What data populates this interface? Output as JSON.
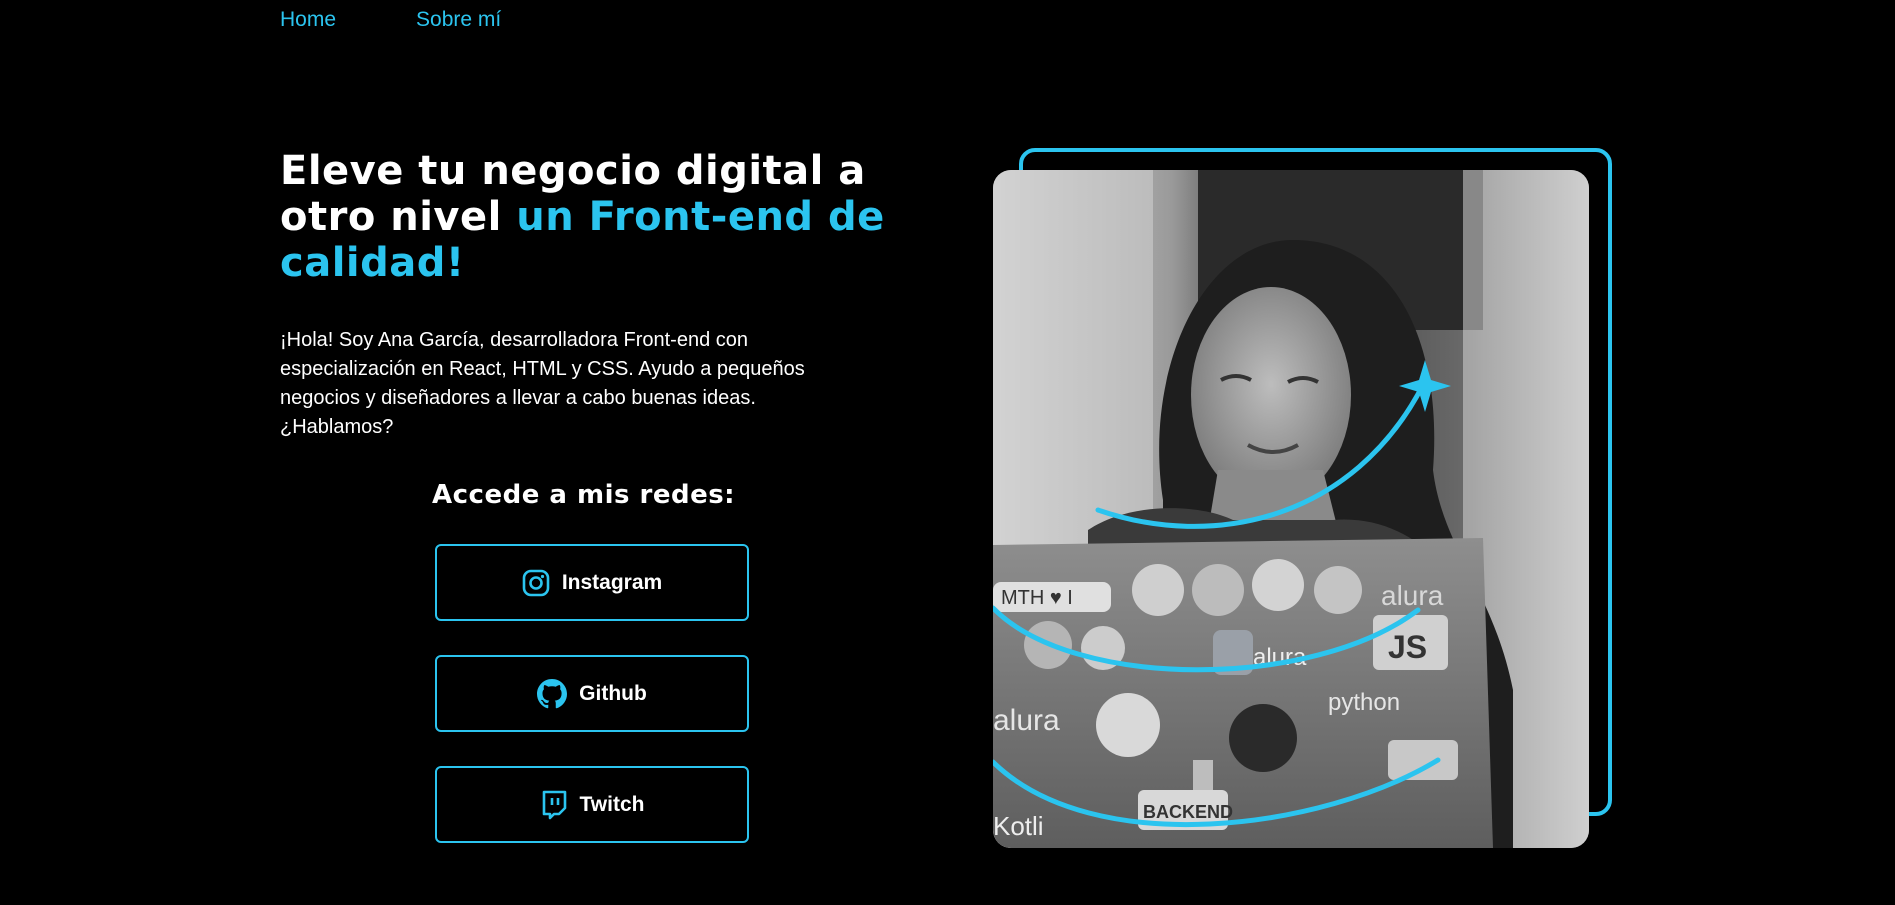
{
  "nav": {
    "home_label": "Home",
    "about_label": "Sobre mí"
  },
  "hero": {
    "title_part1": "Eleve tu negocio digital a otro nivel ",
    "title_accent": "un Front-end de calidad!",
    "intro": "¡Hola! Soy Ana García, desarrolladora Front-end con especialización en React, HTML y CSS. Ayudo a pequeños negocios y diseñadores a llevar a cabo buenas ideas. ¿Hablamos?"
  },
  "socials": {
    "title": "Accede a mis redes:",
    "instagram_label": "Instagram",
    "github_label": "Github",
    "twitch_label": "Twitch",
    "instagram_icon": "instagram-icon",
    "github_icon": "github-icon",
    "twitch_icon": "twitch-icon"
  },
  "photo": {
    "sticker_texts": [
      "MTH ♥ I",
      "alura",
      "JS",
      "alura",
      "python",
      "alura",
      "BACKEND",
      "Kotli"
    ]
  },
  "colors": {
    "accent": "#2bc4ef",
    "background": "#000000",
    "text": "#ffffff"
  }
}
